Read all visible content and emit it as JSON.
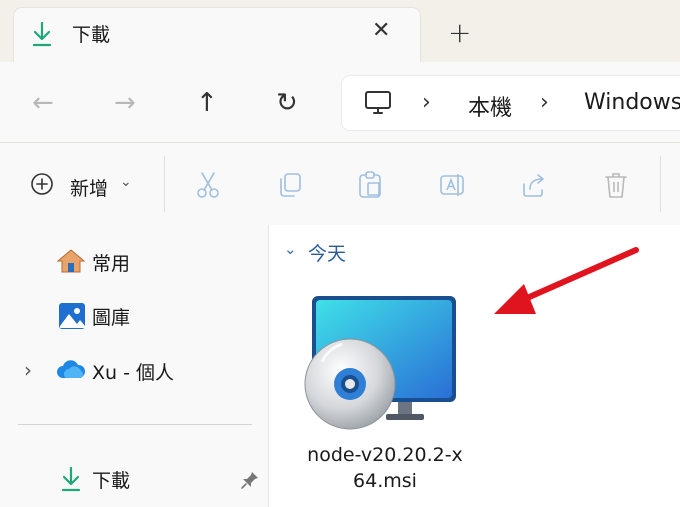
{
  "tab": {
    "title": "下載",
    "close": "✕",
    "new": "+"
  },
  "nav": {
    "back": "←",
    "forward": "→",
    "up": "↑",
    "refresh": "↻"
  },
  "address": {
    "sep": "›",
    "segments": [
      "本機",
      "Windows"
    ]
  },
  "toolbar": {
    "new_label": "新增",
    "caret": "⌄"
  },
  "sidebar": {
    "items": [
      {
        "label": "常用"
      },
      {
        "label": "圖庫"
      },
      {
        "label": "Xu - 個人",
        "expander": "›"
      },
      {
        "label": "下載"
      }
    ]
  },
  "content": {
    "group": {
      "caret": "⌄",
      "label": "今天"
    },
    "file": {
      "line1": "node-v20.20.2-x",
      "line2": "64.msi"
    }
  },
  "colors": {
    "annotation_arrow": "#e0141e",
    "accent_teal": "#1fa67a"
  }
}
